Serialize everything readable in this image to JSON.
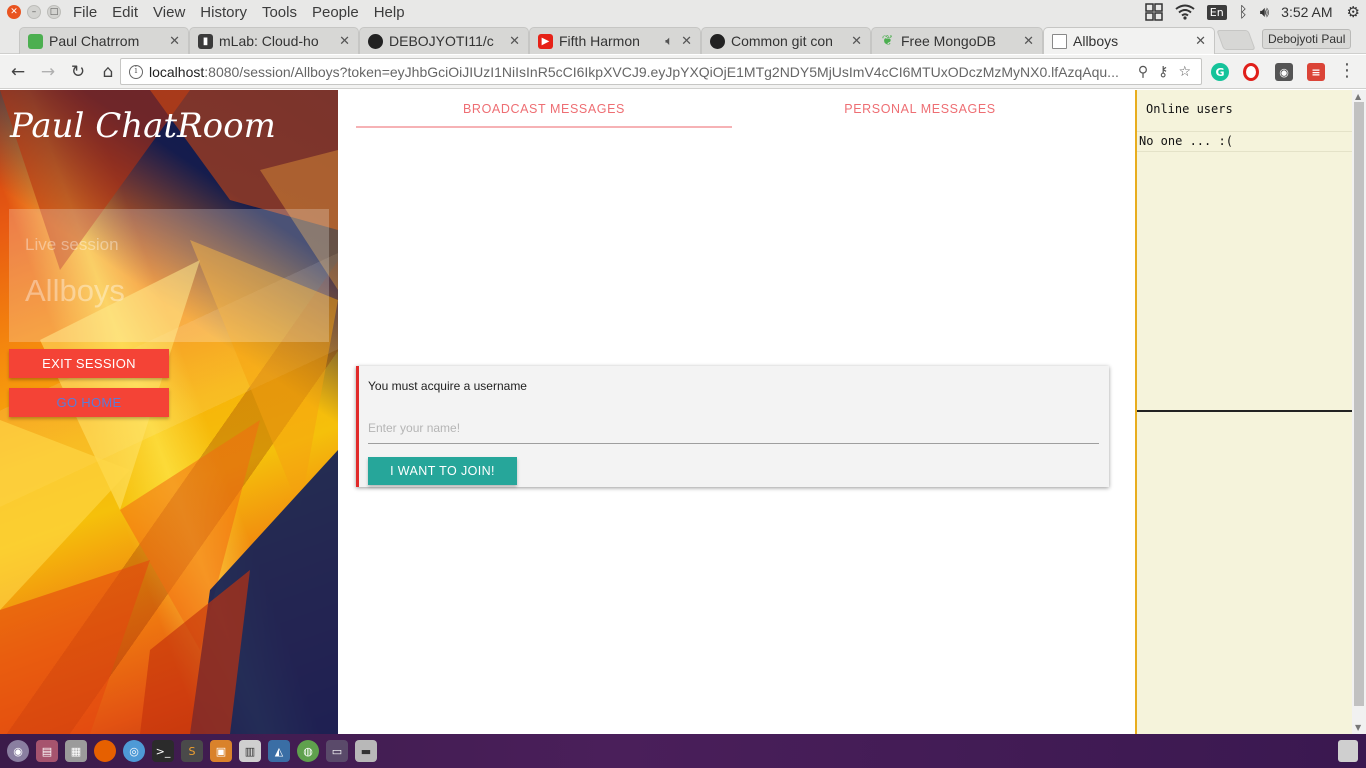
{
  "os_menu": {
    "items": [
      "File",
      "Edit",
      "View",
      "History",
      "Tools",
      "People",
      "Help"
    ],
    "lang": "En",
    "clock": "3:52 AM"
  },
  "browser": {
    "tabs": [
      {
        "title": "Paul Chatrrom",
        "favicon": "cube-icon",
        "color": "#4caf50"
      },
      {
        "title": "mLab: Cloud-ho",
        "favicon": "mlab-icon",
        "color": "#3b3b3b"
      },
      {
        "title": "DEBOJYOTI11/c",
        "favicon": "github-icon",
        "color": "#222222"
      },
      {
        "title": "Fifth Harmon",
        "favicon": "youtube-icon",
        "color": "#e62117"
      },
      {
        "title": "Common git con",
        "favicon": "github-icon",
        "color": "#222222"
      },
      {
        "title": "Free MongoDB",
        "favicon": "leaf-icon",
        "color": "#4caf50"
      },
      {
        "title": "Allboys",
        "favicon": "page-icon",
        "color": "#ffffff"
      }
    ],
    "profile_name": "Debojyoti Paul",
    "url_host": "localhost",
    "url_rest": ":8080/session/Allboys?token=eyJhbGciOiJIUzI1NiIsInR5cCI6IkpXVCJ9.eyJpYXQiOjE1MTg2NDY5MjUsImV4cCI6MTUxODczMzMyNX0.lfAzqAqu..."
  },
  "app": {
    "title": "Paul ChatRoom",
    "session_label": "Live session",
    "session_name": "Allboys",
    "exit_button": "EXIT SESSION",
    "home_button": "GO HOME",
    "tabs": {
      "broadcast": "BROADCAST MESSAGES",
      "personal": "PERSONAL MESSAGES"
    },
    "join": {
      "prompt": "You must acquire a username",
      "placeholder": "Enter your name!",
      "button": "I WANT TO JOIN!"
    },
    "online": {
      "title": "Online users",
      "empty_text": "No one ... :("
    }
  },
  "colors": {
    "accent_red": "#f44336",
    "tab_text": "#ee6e73",
    "join_button": "#26a69a",
    "right_panel_bg": "#f5f3db",
    "right_panel_border": "#e8ad1e"
  }
}
